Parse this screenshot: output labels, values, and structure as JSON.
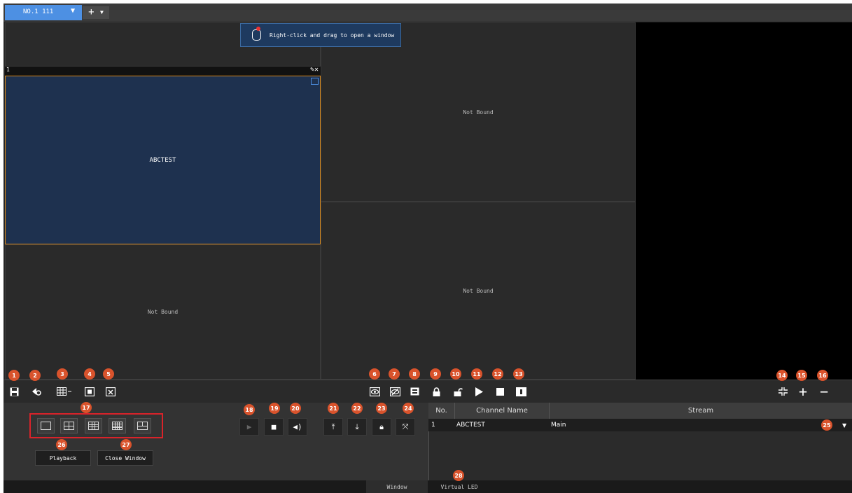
{
  "tabbar": {
    "active_tab": "NO.1 111",
    "add_tab_label": "+"
  },
  "wall": {
    "hint_text": "Right-click and drag to open a window",
    "window_index": "1",
    "window_channel": "ABCTEST",
    "not_bound_label": "Not Bound"
  },
  "toolbar_badges": [
    "1",
    "2",
    "3",
    "4",
    "5",
    "6",
    "7",
    "8",
    "9",
    "10",
    "11",
    "12",
    "13",
    "14",
    "15",
    "16"
  ],
  "panel": {
    "split_badge": "17",
    "playback_badge": "26",
    "close_badge": "27",
    "playback_label": "Playback",
    "close_window_label": "Close Window",
    "control_badges": [
      "18",
      "19",
      "20",
      "21",
      "22",
      "23",
      "24"
    ],
    "dropdown_badge": "25",
    "virtual_led_badge": "28"
  },
  "table": {
    "headers": [
      "No.",
      "Channel Name",
      "Stream"
    ],
    "rows": [
      {
        "no": "1",
        "channel": "ABCTEST",
        "stream": "Main"
      }
    ]
  },
  "status_tabs": [
    "Window",
    "Virtual LED"
  ],
  "colors": {
    "accent": "#4d90e3",
    "badge": "#d9532c",
    "window_border": "#d98a1e",
    "window_fill": "#1e314f",
    "highlight_box": "#d9232a"
  }
}
